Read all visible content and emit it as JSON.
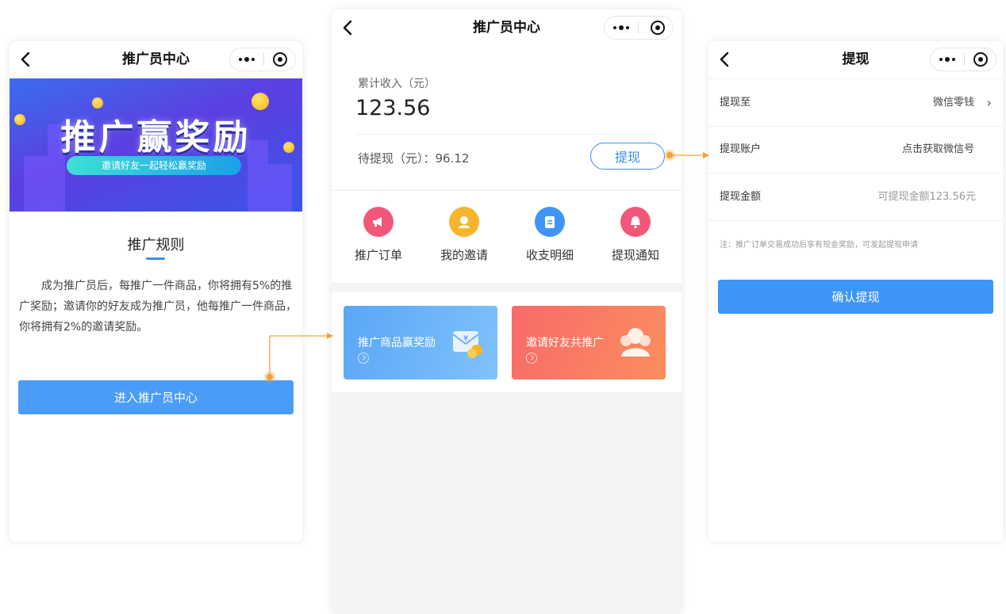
{
  "colors": {
    "accent": "#3a8ef6",
    "connector": "#f2a23a"
  },
  "left_phone": {
    "nav_title": "推广员中心",
    "banner": {
      "title": "推广赢奖励",
      "subtitle": "邀请好友一起轻松赢奖励"
    },
    "rules_title": "推广规则",
    "rules_text": "成为推广员后，每推广一件商品，你将拥有5%的推广奖励；邀请你的好友成为推广员，他每推广一件商品，你将拥有2%的邀请奖励。",
    "enter_button": "进入推广员中心"
  },
  "middle_phone": {
    "nav_title": "推广员中心",
    "income_label": "累计收入（元）",
    "income_value": "123.56",
    "pending_text": "待提现（元）：96.12",
    "withdraw_button": "提现",
    "menu": [
      {
        "label": "推广订单",
        "icon": "megaphone-icon",
        "color": "#f2577a"
      },
      {
        "label": "我的邀请",
        "icon": "user-icon",
        "color": "#f6b52c"
      },
      {
        "label": "收支明细",
        "icon": "clipboard-icon",
        "color": "#3f95f5"
      },
      {
        "label": "提现通知",
        "icon": "bell-icon",
        "color": "#f2577a"
      }
    ],
    "promos": [
      {
        "label": "推广商品赢奖励",
        "icon": "wallet-coin-icon"
      },
      {
        "label": "邀请好友共推广",
        "icon": "friends-icon"
      }
    ]
  },
  "right_phone": {
    "nav_title": "提现",
    "rows": [
      {
        "label": "提现至",
        "value": "微信零钱"
      },
      {
        "label": "提现账户",
        "value": "点击获取微信号"
      },
      {
        "label": "提现金额",
        "placeholder": "可提现金额123.56元"
      }
    ],
    "note": "注：推广订单交易成功后享有现金奖励，可发起提现申请",
    "confirm_button": "确认提现"
  }
}
